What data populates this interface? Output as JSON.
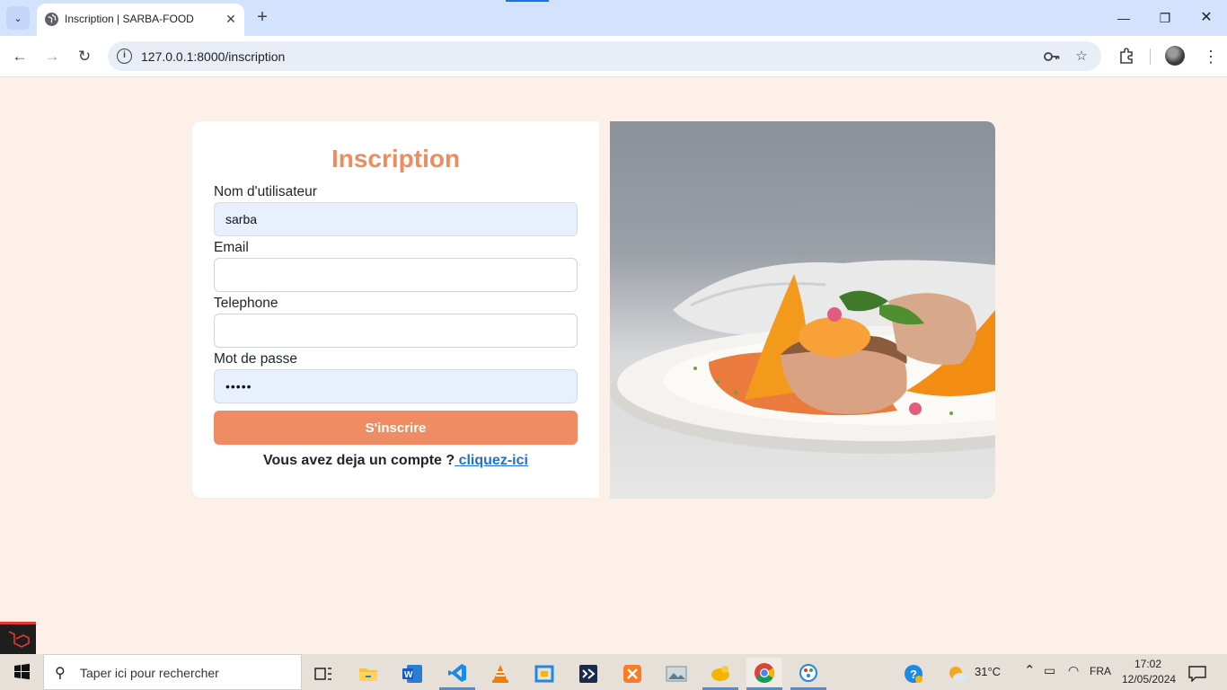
{
  "browser": {
    "tab_title": "Inscription | SARBA-FOOD",
    "url": "127.0.0.1:8000/inscription",
    "icons": [
      "tab-list-icon",
      "globe-icon",
      "close-icon",
      "plus-icon",
      "minimize-icon",
      "restore-icon",
      "window-close-icon",
      "back-arrow-icon",
      "forward-arrow-icon",
      "reload-icon",
      "info-icon",
      "key-icon",
      "star-icon",
      "extensions-icon",
      "profile-avatar",
      "kebab-menu-icon"
    ]
  },
  "form": {
    "title": "Inscription",
    "username_label": "Nom d'utilisateur",
    "username_value": "sarba",
    "email_label": "Email",
    "email_value": "",
    "phone_label": "Telephone",
    "phone_value": "",
    "password_label": "Mot de passe",
    "password_value": "•••••",
    "submit_label": "S'inscrire",
    "login_prompt": "Vous avez deja un compte ?",
    "login_link": " cliquez-ici"
  },
  "taskbar": {
    "search_placeholder": "Taper ici pour rechercher",
    "weather": "31°C",
    "language": "FRA",
    "time": "17:02",
    "date": "12/05/2024",
    "apps": [
      "task-view",
      "file-explorer",
      "word",
      "vscode",
      "vlc",
      "virtualbox",
      "visual-studio",
      "xampp",
      "photos",
      "dbeaver",
      "chrome",
      "paint"
    ]
  },
  "colors": {
    "accent": "#ee8c60",
    "page_bg": "#fdf0e8",
    "link": "#1f6fd6",
    "autofill": "#e8f0fe"
  }
}
